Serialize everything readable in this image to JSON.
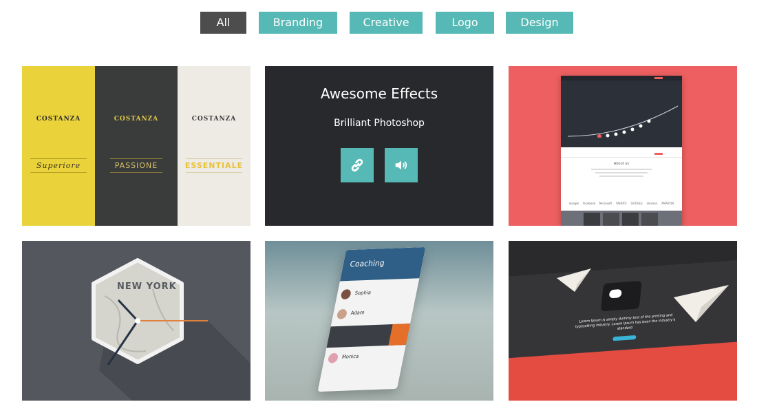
{
  "filters": [
    {
      "label": "All",
      "active": true
    },
    {
      "label": "Branding",
      "active": false
    },
    {
      "label": "Creative",
      "active": false
    },
    {
      "label": "Logo",
      "active": false
    },
    {
      "label": "Design",
      "active": false
    }
  ],
  "portfolio": {
    "item1": {
      "brand": "COSTANZA",
      "panels": [
        {
          "word": "Superiore",
          "bg": "#ead33a"
        },
        {
          "word": "PASSIONE",
          "bg": "#3a3b3b"
        },
        {
          "word": "ESSENTIALE",
          "bg": "#eeeae4"
        }
      ]
    },
    "item2": {
      "title": "Awesome Effects",
      "subtitle": "Brilliant Photoshop",
      "link_icon": "link-icon",
      "sound_icon": "speaker-icon"
    },
    "item3": {
      "bg": "#ed5f60",
      "about": "About us",
      "clients": [
        "Google",
        "facebook",
        "Microsoft",
        "YAHOO!",
        "GOOGLE",
        "amazon",
        "AMAZON"
      ]
    },
    "item4": {
      "city": "NEW YORK"
    },
    "item5": {
      "app_title": "Coaching",
      "contacts": [
        "Sophia",
        "Adam",
        "Monica"
      ]
    },
    "item6": {
      "hero_text": "Lorem Ipsum is simply dummy text of the printing and typesetting industry. Lorem Ipsum has been the industry's standard",
      "accent": "#e44c41"
    }
  },
  "colors": {
    "accent": "#56b9b5",
    "active_filter": "#4d4d4d"
  }
}
